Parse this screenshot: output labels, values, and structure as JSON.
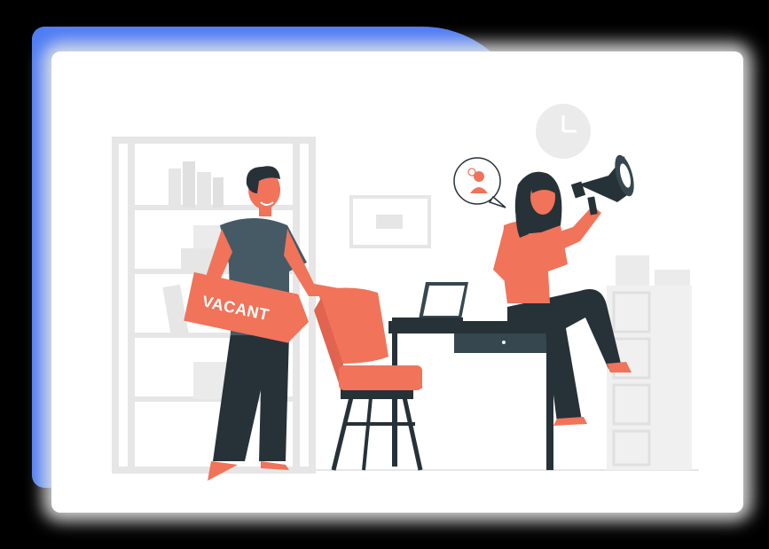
{
  "illustration": {
    "sign_text": "VACANT",
    "icons": [
      "megaphone-icon",
      "user-bubble-icon",
      "clock-icon",
      "laptop-icon"
    ]
  },
  "colors": {
    "accent_blue": "#4E7CF5",
    "accent_coral": "#F0735A",
    "dark": "#263238",
    "light_gray": "#E6E6E6",
    "card_white": "#FFFFFF",
    "background": "#000000"
  }
}
